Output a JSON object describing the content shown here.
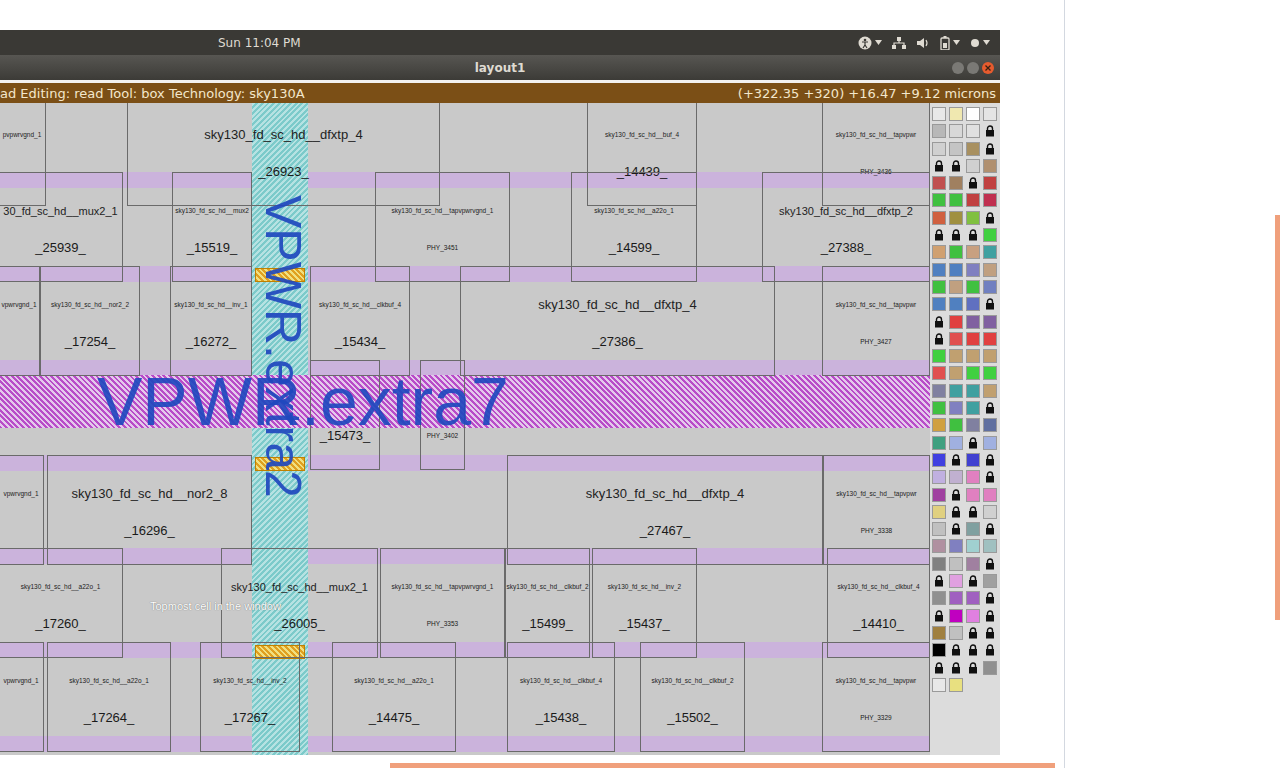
{
  "topbar": {
    "time": "Sun 11:04 PM"
  },
  "window": {
    "title": "layout1"
  },
  "statusbar": {
    "left": "ad Editing: read Tool: box Technology: sky130A",
    "right": "(+322.35 +320) +16.47 +9.12 microns"
  },
  "canvas": {
    "labels": {
      "horizontal": "VPWR.extra7",
      "vertical": "VPWR.extra2",
      "hint": "Topmost cell in the window"
    },
    "rows": [
      {
        "cells": [
          {
            "type": "pvpwrvgnd_1",
            "kind": "small"
          },
          {
            "type": "sky130_fd_sc_hd__dfxtp_4",
            "instance": "_26923_",
            "kind": "large"
          },
          {
            "type": "sky130_fd_sc_hd__buf_4",
            "instance": "_14439_",
            "kind": "small"
          },
          {
            "type": "sky130_fd_sc_hd__tapvpwr",
            "instance": "PHY_3436",
            "kind": "tap"
          }
        ]
      },
      {
        "cells": [
          {
            "type": "30_fd_sc_hd__mux2_1",
            "instance": "_25939_",
            "kind": "medium"
          },
          {
            "type": "sky130_fd_sc_hd__mux2",
            "instance": "_15519_",
            "kind": "small"
          },
          {
            "type": "sky130_fd_sc_hd__tapvpwrvgnd_1",
            "instance": "PHY_3451",
            "kind": "tap"
          },
          {
            "type": "sky130_fd_sc_hd__a22o_1",
            "instance": "_14599_",
            "kind": "small"
          },
          {
            "type": "sky130_fd_sc_hd__dfxtp_2",
            "instance": "_27388_",
            "kind": "medium"
          }
        ]
      },
      {
        "cells": [
          {
            "type": "vpwrvgnd_1",
            "kind": "small"
          },
          {
            "type": "sky130_fd_sc_hd__nor2_2",
            "instance": "_17254_",
            "kind": "small"
          },
          {
            "type": "sky130_fd_sc_hd__inv_1",
            "instance": "_16272_",
            "kind": "small"
          },
          {
            "type": "sky130_fd_sc_hd__clkbuf_4",
            "instance": "_15434_",
            "kind": "small"
          },
          {
            "type": "sky130_fd_sc_hd__dfxtp_4",
            "instance": "_27386_",
            "kind": "large"
          },
          {
            "type": "sky130_fd_sc_hd__tapvpwr",
            "instance": "PHY_3427",
            "kind": "tap"
          }
        ]
      },
      {
        "cells": [
          {
            "instance": "_15473_",
            "kind": "small"
          },
          {
            "instance": "PHY_3402",
            "kind": "tap"
          }
        ]
      },
      {
        "cells": [
          {
            "type": "vpwrvgnd_1",
            "kind": "small"
          },
          {
            "type": "sky130_fd_sc_hd__nor2_8",
            "instance": "_16296_",
            "kind": "large"
          },
          {
            "type": "sky130_fd_sc_hd__dfxtp_4",
            "instance": "_27467_",
            "kind": "large"
          },
          {
            "type": "sky130_fd_sc_hd__tapvpwr",
            "instance": "PHY_3338",
            "kind": "tap"
          }
        ]
      },
      {
        "cells": [
          {
            "type": "sky130_fd_sc_hd__a22o_1",
            "instance": "_17260_",
            "kind": "small"
          },
          {
            "type": "sky130_fd_sc_hd__mux2_1",
            "instance": "_26005_",
            "kind": "medium"
          },
          {
            "type": "sky130_fd_sc_hd__tapvpwrvgnd_1",
            "instance": "PHY_3353",
            "kind": "tap"
          },
          {
            "type": "sky130_fd_sc_hd__clkbuf_2",
            "instance": "_15499_",
            "kind": "small"
          },
          {
            "type": "sky130_fd_sc_hd__inv_2",
            "instance": "_15437_",
            "kind": "small"
          },
          {
            "type": "sky130_fd_sc_hd__clkbuf_4",
            "instance": "_14410_",
            "kind": "small"
          }
        ]
      },
      {
        "cells": [
          {
            "type": "vpwrvgnd_1",
            "kind": "small"
          },
          {
            "type": "sky130_fd_sc_hd__a22o_1",
            "instance": "_17264_",
            "kind": "small"
          },
          {
            "type": "sky130_fd_sc_hd__inv_2",
            "instance": "_17267_",
            "kind": "small"
          },
          {
            "type": "sky130_fd_sc_hd__a22o_1",
            "instance": "_14475_",
            "kind": "small"
          },
          {
            "type": "sky130_fd_sc_hd__clkbuf_4",
            "instance": "_15438_",
            "kind": "small"
          },
          {
            "type": "sky130_fd_sc_hd__clkbuf_2",
            "instance": "_15502_",
            "kind": "small"
          },
          {
            "type": "sky130_fd_sc_hd__tapvpwr",
            "instance": "PHY_3329",
            "kind": "tap"
          }
        ]
      }
    ]
  },
  "palette": [
    [
      "#e8e8e8",
      "#f0e8b0",
      "#ffffff",
      "#e4e4e4"
    ],
    [
      "#b8b8b8",
      "#d8d8d8",
      "#e0e0e0",
      "lock"
    ],
    [
      "#d0d0d0",
      "#c4c4c4",
      "#a89060",
      "lock"
    ],
    [
      "lock",
      "lock",
      "#d0d0d0",
      "#b09070"
    ],
    [
      "#c05050",
      "#a08060",
      "lock",
      "#c04040"
    ],
    [
      "#40c040",
      "#40c040",
      "#c04040",
      "#c03050"
    ],
    [
      "#d06040",
      "#a09040",
      "#80c040",
      "lock"
    ],
    [
      "lock",
      "lock",
      "lock",
      "#40d040"
    ],
    [
      "#d0a070",
      "#40c040",
      "#c8a080",
      "#40a0a0"
    ],
    [
      "#5080c0",
      "#5080c0",
      "#8080c0",
      "#c0a080"
    ],
    [
      "#40c040",
      "#c0a080",
      "#40c040",
      "#7080c0"
    ],
    [
      "#5080c0",
      "#5080c0",
      "#6070c0",
      "lock"
    ],
    [
      "lock",
      "#e04040",
      "#8060a0",
      "#8060a0"
    ],
    [
      "lock",
      "#e05050",
      "#e04040",
      "#e04040"
    ],
    [
      "#40d040",
      "#c0a070",
      "#c0a070",
      "#c0a070"
    ],
    [
      "#e05050",
      "#c0a070",
      "#40d040",
      "#40d040"
    ],
    [
      "#8080a0",
      "#40a0a0",
      "#40a0a0",
      "#c0a070"
    ],
    [
      "#40c040",
      "#8080c0",
      "#40a0a0",
      "lock"
    ],
    [
      "#d0a040",
      "#40c040",
      "#8080a0",
      "#6070a0"
    ],
    [
      "#40a080",
      "#a0b0e0",
      "lock",
      "#a0b0e0"
    ],
    [
      "#4040e0",
      "lock",
      "#4040d0",
      "lock"
    ],
    [
      "#c0b0e0",
      "#c0b0d0",
      "#e080c0",
      "lock"
    ],
    [
      "#a040a0",
      "lock",
      "#e080c0",
      "#e080c0"
    ],
    [
      "#e0d080",
      "lock",
      "lock",
      "#d0d0d0"
    ],
    [
      "#c0c0c0",
      "lock",
      "#80a0a0",
      "lock"
    ],
    [
      "#b090a0",
      "#8080c0",
      "#a0d0d0",
      "#a0c0c0"
    ],
    [
      "#808080",
      "#c0c0c0",
      "#a080a0",
      "lock"
    ],
    [
      "lock",
      "#e0a0e0",
      "lock",
      "#a0a0a0"
    ],
    [
      "#909090",
      "#a060c0",
      "#a060c0",
      "lock"
    ],
    [
      "lock",
      "#c000c0",
      "#e080e0",
      "lock"
    ],
    [
      "#a08040",
      "#c0c0c0",
      "lock",
      "lock"
    ],
    [
      "#000000",
      "lock",
      "lock",
      "lock"
    ],
    [
      "lock",
      "lock",
      "lock",
      "#909090"
    ],
    [
      "#e8e8e8",
      "#e8e080"
    ]
  ]
}
